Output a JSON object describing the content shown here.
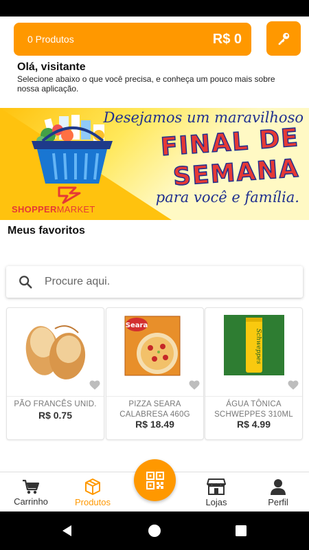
{
  "header": {
    "cart_count": "0 Produtos",
    "cart_total": "R$ 0"
  },
  "greeting": {
    "title": "Olá, visitante",
    "text": "Selecione abaixo o que você precisa, e conheça um pouco mais sobre nossa aplicação."
  },
  "banner": {
    "line1": "Desejamos um maravilhoso",
    "line2": "FINAL DE",
    "line3": "SEMANA",
    "line4": "para você e família.",
    "logo_brand": "SHOPPER",
    "logo_suffix": "MARKET"
  },
  "favorites": {
    "title": "Meus favoritos"
  },
  "search": {
    "placeholder": "Procure aqui."
  },
  "products": [
    {
      "name": "PÃO FRANCÊS UNID.",
      "price": "R$ 0.75"
    },
    {
      "name": "PIZZA SEARA CALABRESA 460G",
      "price": "R$ 18.49",
      "package_brand": "Seara"
    },
    {
      "name": "ÁGUA TÔNICA SCHWEPPES 310ML",
      "price": "R$ 4.99",
      "package_brand": "Schweppes"
    }
  ],
  "nav": {
    "items": [
      {
        "label": "Carrinho",
        "icon": "cart-icon"
      },
      {
        "label": "Produtos",
        "icon": "box-icon",
        "active": true
      },
      {
        "label": "Lojas",
        "icon": "store-icon"
      },
      {
        "label": "Perfil",
        "icon": "person-icon"
      }
    ]
  },
  "colors": {
    "accent": "#ff9800",
    "banner_blue": "#1f2f8f",
    "banner_red": "#e53935"
  }
}
